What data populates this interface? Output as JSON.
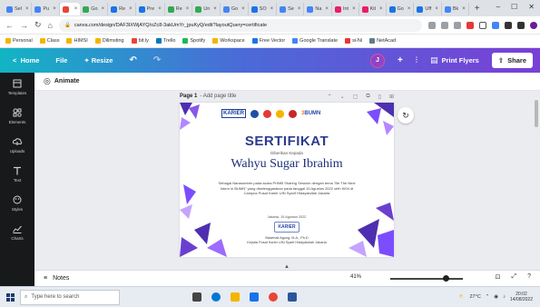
{
  "browser": {
    "tabs": [
      {
        "label": "Sel",
        "color": "#4285f4"
      },
      {
        "label": "Pu",
        "color": "#4285f4"
      },
      {
        "label": "",
        "color": "#ea4335",
        "active": true
      },
      {
        "label": "Go",
        "color": "#34a853"
      },
      {
        "label": "Re",
        "color": "#1a73e8"
      },
      {
        "label": "Pre",
        "color": "#1a73e8"
      },
      {
        "label": "Re",
        "color": "#34a853"
      },
      {
        "label": "Un",
        "color": "#34a853"
      },
      {
        "label": "Go",
        "color": "#4285f4"
      },
      {
        "label": "SO",
        "color": "#1a73e8"
      },
      {
        "label": "Se",
        "color": "#4285f4"
      },
      {
        "label": "Na",
        "color": "#4285f4"
      },
      {
        "label": "Int",
        "color": "#e91e63"
      },
      {
        "label": "Kit",
        "color": "#e91e63"
      },
      {
        "label": "Go",
        "color": "#1a73e8"
      },
      {
        "label": "Uff",
        "color": "#1a73e8"
      },
      {
        "label": "Bk",
        "color": "#4285f4"
      }
    ],
    "url": "canva.com/design/DAF3IXWjAYQ/oZc8-3akUmYr_jpuKyQ/edit?layoutQuery=certificate",
    "window_controls": [
      "–",
      "☐",
      "✕"
    ]
  },
  "bookmarks": [
    {
      "label": "Personal",
      "color": "#f4b400"
    },
    {
      "label": "Class",
      "color": "#f4b400"
    },
    {
      "label": "HIMSI",
      "color": "#f4b400"
    },
    {
      "label": "Dilimsting",
      "color": "#f4b400"
    },
    {
      "label": "bit.ly",
      "color": "#ea4335"
    },
    {
      "label": "Trello",
      "color": "#0079bf"
    },
    {
      "label": "Spotify",
      "color": "#1db954"
    },
    {
      "label": "Workspace",
      "color": "#f4b400"
    },
    {
      "label": "Free Vector",
      "color": "#1a73e8"
    },
    {
      "label": "Google Translate",
      "color": "#4285f4"
    },
    {
      "label": "si-Ni",
      "color": "#e53935"
    },
    {
      "label": "NetAcad",
      "color": "#607d8b"
    }
  ],
  "canva_header": {
    "home": "Home",
    "file": "File",
    "resize": "Resize",
    "avatar_initial": "J",
    "print_label": "Print Flyers",
    "share_label": "Share"
  },
  "sidebar": [
    {
      "label": "Templates",
      "icon": "templates-icon"
    },
    {
      "label": "Elements",
      "icon": "elements-icon"
    },
    {
      "label": "Uploads",
      "icon": "uploads-icon"
    },
    {
      "label": "Text",
      "icon": "text-icon"
    },
    {
      "label": "Styles",
      "icon": "styles-icon"
    },
    {
      "label": "Charts",
      "icon": "charts-icon"
    }
  ],
  "toolbar": {
    "animate": "Animate"
  },
  "page": {
    "label": "Page 1",
    "title_placeholder": "- Add page title"
  },
  "certificate": {
    "logo_karier": "KARIER",
    "logo_bumn": "BUMN",
    "title": "SERTIFIKAT",
    "given_to": "Diberikan Kepada",
    "name": "Wahyu Sugar Ibrahim",
    "body": "Sebagai Narasumber pada acara PHMB Sharing Session dengan tema \"Be The Next Intern in BUMN\" yang diselenggarakan pada tanggal 15 Agustus 2022 oleh KKN di Campus Pusat Karier UIN Syarif Hidayatullah Jakarta",
    "date": "Jakarta, 15 Agustus 2022",
    "sig_mark": "KARIER",
    "signer_name": "Balarhati Agung, M.A., Ph.D",
    "signer_role": "Kepala Pusat Karier UIN Syarif Hidayatullah Jakarta",
    "accent_purple": "#6a3fd0",
    "accent_blue": "#2b3c8f"
  },
  "footer": {
    "notes": "Notes",
    "zoom": "41%"
  },
  "taskbar": {
    "search_placeholder": "Type here to search",
    "temperature": "27°C",
    "time": "20:02",
    "date": "14/08/2022"
  }
}
